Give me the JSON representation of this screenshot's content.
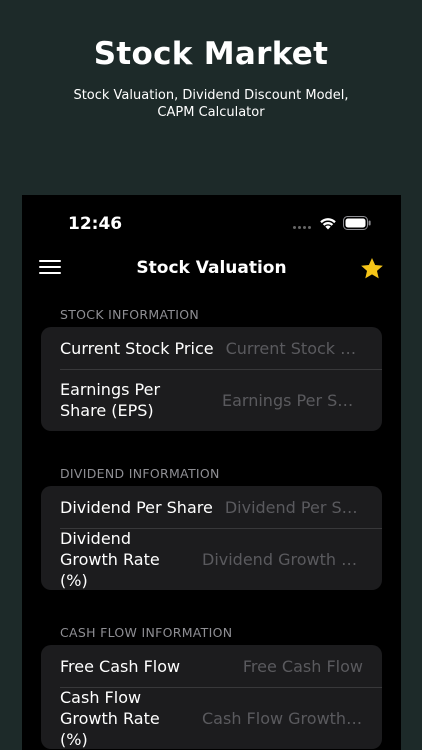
{
  "promo": {
    "title": "Stock Market",
    "subtitle": "Stock Valuation, Dividend Discount Model, CAPM Calculator"
  },
  "status_bar": {
    "time": "12:46"
  },
  "nav": {
    "title": "Stock Valuation",
    "menu_icon": "hamburger-menu-icon",
    "favorite_icon": "star-icon",
    "favorite_color": "#f5c518"
  },
  "sections": {
    "stock": {
      "header": "STOCK INFORMATION",
      "rows": [
        {
          "label": "Current Stock Price",
          "placeholder": "Current Stock Price",
          "value": ""
        },
        {
          "label": "Earnings Per Share (EPS)",
          "placeholder": "Earnings Per Share",
          "value": ""
        }
      ]
    },
    "dividend": {
      "header": "DIVIDEND INFORMATION",
      "rows": [
        {
          "label": "Dividend Per Share",
          "placeholder": "Dividend Per Share",
          "value": ""
        },
        {
          "label": "Dividend Growth Rate (%)",
          "placeholder": "Dividend Growth Rate",
          "value": ""
        }
      ]
    },
    "cashflow": {
      "header": "CASH FLOW INFORMATION",
      "rows": [
        {
          "label": "Free Cash Flow",
          "placeholder": "Free Cash Flow",
          "value": ""
        },
        {
          "label": "Cash Flow Growth Rate (%)",
          "placeholder": "Cash Flow Growth Rate",
          "value": ""
        }
      ]
    }
  }
}
